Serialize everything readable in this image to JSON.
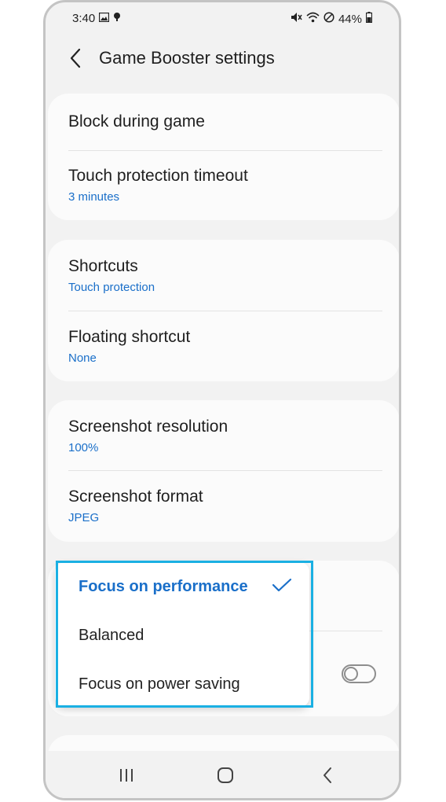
{
  "status_bar": {
    "time": "3:40",
    "battery": "44%",
    "left_icons": [
      "gallery-icon",
      "notification-dot-icon"
    ],
    "right_icons": [
      "mute-icon",
      "wifi-icon",
      "dnd-icon",
      "battery-icon"
    ]
  },
  "header": {
    "title": "Game Booster settings",
    "back_icon": "back-chevron-icon"
  },
  "groups": [
    {
      "items": [
        {
          "title": "Block during game",
          "subtitle": ""
        },
        {
          "title": "Touch protection timeout",
          "subtitle": "3 minutes"
        }
      ]
    },
    {
      "items": [
        {
          "title": "Shortcuts",
          "subtitle": "Touch protection"
        },
        {
          "title": "Floating shortcut",
          "subtitle": "None"
        }
      ]
    },
    {
      "items": [
        {
          "title": "Screenshot resolution",
          "subtitle": "100%"
        },
        {
          "title": "Screenshot format",
          "subtitle": "JPEG"
        }
      ]
    }
  ],
  "popup": {
    "options": [
      {
        "label": "Focus on performance",
        "selected": true
      },
      {
        "label": "Balanced",
        "selected": false
      },
      {
        "label": "Focus on power saving",
        "selected": false
      }
    ]
  },
  "toggle": {
    "on": false
  },
  "colors": {
    "accent": "#1a6fc9",
    "highlight_border": "#1ab0e3",
    "background": "#f2f2f2",
    "card": "#fbfbfb"
  },
  "nav_bar": [
    "recents-icon",
    "home-icon",
    "back-icon"
  ]
}
